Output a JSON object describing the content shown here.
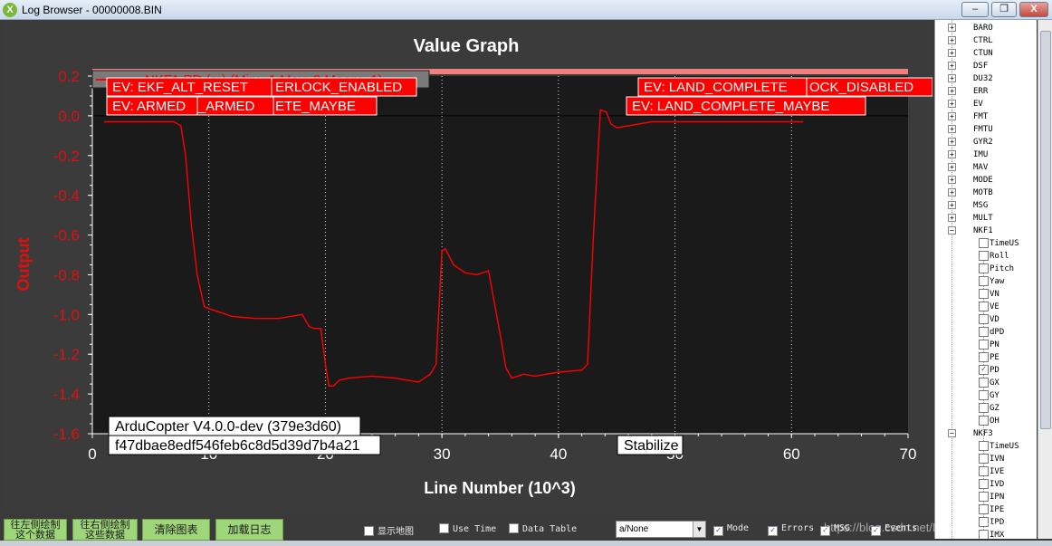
{
  "window": {
    "title": "Log Browser - 00000008.BIN",
    "icon": "app-logo-icon",
    "minimize_glyph": "‒",
    "maximize_glyph": "❐",
    "close_glyph": "X"
  },
  "chart_data": {
    "type": "line",
    "title": "Value Graph",
    "xlabel": "Line Number (10^3)",
    "ylabel": "Output",
    "xlim": [
      0,
      70
    ],
    "ylim": [
      -1.6,
      0.2
    ],
    "x_ticks": [
      "0",
      "10",
      "20",
      "30",
      "40",
      "50",
      "60",
      "70"
    ],
    "y_ticks": [
      "0.2",
      "0.0",
      "-0.2",
      "-0.4",
      "-0.6",
      "-0.8",
      "-1.0",
      "-1.2",
      "-1.4",
      "-1.6"
    ],
    "grid": "vertical dotted lines at event markers",
    "event_lines": [
      10,
      20,
      30,
      40,
      50,
      60
    ],
    "series": [
      {
        "name": "NKF1.PD (m) (Min: -1 Max: 0 Mean: -1)",
        "color": "#ff0000",
        "x": [
          1,
          7,
          7.6,
          8,
          8.5,
          9,
          9.6,
          10,
          11,
          12,
          14,
          16,
          18,
          18.6,
          19,
          19.6,
          20,
          20.3,
          20.7,
          21.2,
          22,
          24,
          26,
          27,
          28,
          28.5,
          29,
          29.5,
          30,
          30.3,
          31,
          32,
          33,
          34,
          35,
          35.5,
          36,
          37,
          38,
          39,
          40,
          42,
          42.5,
          43,
          43.6,
          44.1,
          44.5,
          45,
          46,
          47,
          48,
          50,
          55,
          61
        ],
        "y": [
          -0.03,
          -0.03,
          -0.05,
          -0.2,
          -0.55,
          -0.8,
          -0.96,
          -0.97,
          -0.99,
          -1.01,
          -1.02,
          -1.02,
          -1.0,
          -1.06,
          -1.07,
          -1.07,
          -1.25,
          -1.36,
          -1.36,
          -1.33,
          -1.32,
          -1.31,
          -1.32,
          -1.33,
          -1.34,
          -1.32,
          -1.3,
          -1.25,
          -0.68,
          -0.67,
          -0.75,
          -0.79,
          -0.8,
          -0.78,
          -1.1,
          -1.27,
          -1.32,
          -1.3,
          -1.31,
          -1.3,
          -1.29,
          -1.28,
          -1.25,
          -0.6,
          0.03,
          0.02,
          -0.04,
          -0.06,
          -0.05,
          -0.04,
          -0.03,
          -0.03,
          -0.03,
          -0.03
        ]
      }
    ],
    "legend": "top-left",
    "legend_text": "NKF1.PD (m) (Min: -1 Max: 0 Mean: -1)",
    "events_left": [
      "EV: EKF_ALT_RESET",
      "ERLOCK_ENABLED",
      "EV: ARMED",
      "D_ARMED",
      "ETE_MAYBE"
    ],
    "events_right": [
      "EV: LAND_COMPLETE",
      "OCK_DISABLED",
      "EV: LAND_COMPLETE_MAYBE"
    ],
    "info_boxes": [
      "ArduCopter V4.0.0-dev (379e3d60)",
      "f47dbae8edf546feb6c8d5d39d7b4a21"
    ],
    "mode_box": "Stabilize"
  },
  "tree": {
    "expand_plus": "+",
    "expand_minus": "−",
    "check_mark": "✓",
    "groups_top": [
      "BARO",
      "CTRL",
      "CTUN",
      "DSF",
      "DU32",
      "ERR",
      "EV",
      "FMT",
      "FMTU",
      "GYR2",
      "IMU",
      "MAV",
      "MODE",
      "MOTB",
      "MSG",
      "MULT"
    ],
    "nkf1": {
      "label": "NKF1",
      "items": [
        "TimeUS",
        "Roll",
        "Pitch",
        "Yaw",
        "VN",
        "VE",
        "VD",
        "dPD",
        "PN",
        "PE",
        "PD",
        "GX",
        "GY",
        "GZ",
        "OH"
      ],
      "checked": [
        "PD"
      ]
    },
    "nkf3": {
      "label": "NKF3",
      "items": [
        "TimeUS",
        "IVN",
        "IVE",
        "IVD",
        "IPN",
        "IPE",
        "IPD",
        "IMX"
      ]
    }
  },
  "toolbar": {
    "btn_left_plot": "往左侧绘制\n这个数据",
    "btn_right_plot": "往右侧绘制\n这些数据",
    "btn_clear": "清除图表",
    "btn_load": "加载日志",
    "opt_map": "显示地图",
    "opt_time": "Use Time",
    "opt_table": "Data Table",
    "combo_value": "a/None",
    "combo_arrow": "▼",
    "opt_mode": "Mode",
    "opt_errors": "Errors",
    "opt_msg": "MSG",
    "opt_events": "Events",
    "mode_checked": "✓",
    "errors_checked": "✓",
    "msg_checked": "✓",
    "events_checked": "✓"
  },
  "watermark": "https://blog.csdn.net/LINGTUI_TBUS"
}
